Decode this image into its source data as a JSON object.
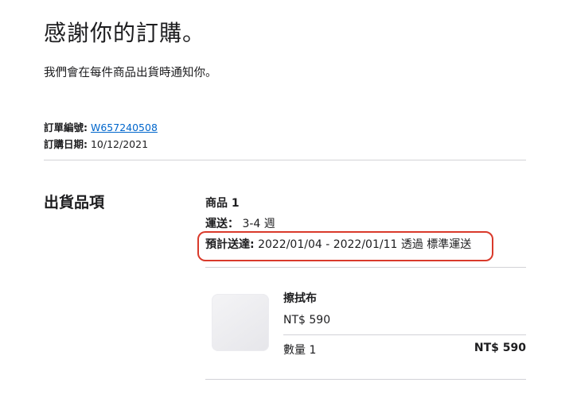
{
  "header": {
    "title": "感謝你的訂購。",
    "subtitle": "我們會在每件商品出貨時通知你。"
  },
  "order": {
    "number_label": "訂單編號:",
    "number_value": "W657240508",
    "date_label": "訂購日期:",
    "date_value": "10/12/2021"
  },
  "section": {
    "title": "出貨品項"
  },
  "shipment": {
    "heading": "商品 1",
    "shipping_label": "運送：",
    "shipping_value": "3-4 週",
    "estimate_label": "預計送達:",
    "estimate_value": "2022/01/04 - 2022/01/11 透過 標準運送",
    "highlight_color": "#d93a2b"
  },
  "item": {
    "name": "擦拭布",
    "price": "NT$ 590",
    "quantity": "數量 1",
    "total": "NT$ 590",
    "image_icon": "polishing-cloth-image"
  },
  "colors": {
    "link": "#0066cc",
    "text": "#1d1d1f",
    "divider": "#d2d2d7"
  }
}
